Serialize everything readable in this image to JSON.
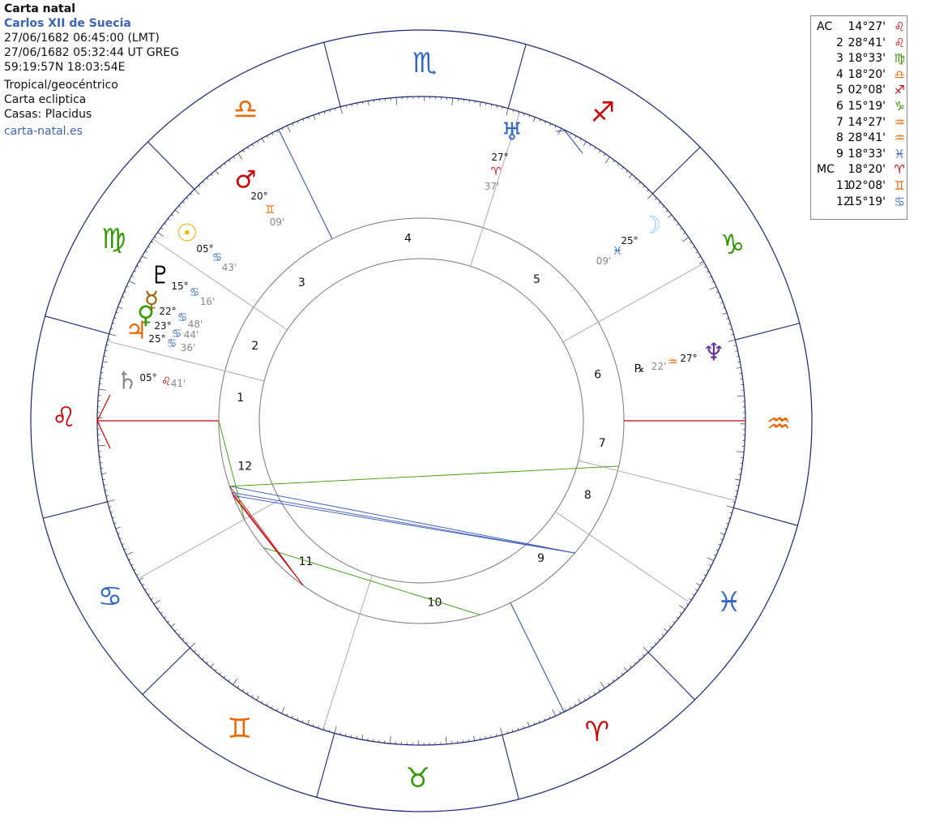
{
  "chart_info": {
    "title": "Carta natal",
    "name": "Carlos XII de Suecia",
    "local_time": "27/06/1682 06:45:00 (LMT)",
    "ut_time": "27/06/1682 05:32:44 UT GREG",
    "coords": "59:19:57N 18:03:54E",
    "system": "Tropical/geocéntrico",
    "chart_type": "Carta ecliptica",
    "houses": "Casas: Placidus",
    "site": "carta-natal.es"
  },
  "house_cusps": [
    {
      "label": "AC",
      "value": "14°27'",
      "sign": "♌",
      "color": "#cc0000"
    },
    {
      "label": "2",
      "value": "28°41'",
      "sign": "♌",
      "color": "#cc0000"
    },
    {
      "label": "3",
      "value": "18°33'",
      "sign": "♍",
      "color": "#339900"
    },
    {
      "label": "4",
      "value": "18°20'",
      "sign": "♎",
      "color": "#ee6600"
    },
    {
      "label": "5",
      "value": "02°08'",
      "sign": "♐",
      "color": "#cc0000"
    },
    {
      "label": "6",
      "value": "15°19'",
      "sign": "♑",
      "color": "#339900"
    },
    {
      "label": "7",
      "value": "14°27'",
      "sign": "♒",
      "color": "#ee6600"
    },
    {
      "label": "8",
      "value": "28°41'",
      "sign": "♒",
      "color": "#ee6600"
    },
    {
      "label": "9",
      "value": "18°33'",
      "sign": "♓",
      "color": "#3366cc"
    },
    {
      "label": "MC",
      "value": "18°20'",
      "sign": "♈",
      "color": "#cc0000"
    },
    {
      "label": "11",
      "value": "02°08'",
      "sign": "♊",
      "color": "#ee6600"
    },
    {
      "label": "12",
      "value": "15°19'",
      "sign": "♋",
      "color": "#3366cc"
    }
  ],
  "zodiac_signs": [
    {
      "name": "aries-icon",
      "glyph": "♈",
      "color": "#cc0000"
    },
    {
      "name": "taurus-icon",
      "glyph": "♉",
      "color": "#339900"
    },
    {
      "name": "gemini-icon",
      "glyph": "♊",
      "color": "#ee6600"
    },
    {
      "name": "cancer-icon",
      "glyph": "♋",
      "color": "#3366cc"
    },
    {
      "name": "leo-icon",
      "glyph": "♌",
      "color": "#cc0000"
    },
    {
      "name": "virgo-icon",
      "glyph": "♍",
      "color": "#339900"
    },
    {
      "name": "libra-icon",
      "glyph": "♎",
      "color": "#ee6600"
    },
    {
      "name": "scorpio-icon",
      "glyph": "♏",
      "color": "#3366cc"
    },
    {
      "name": "sagittarius-icon",
      "glyph": "♐",
      "color": "#cc0000"
    },
    {
      "name": "capricorn-icon",
      "glyph": "♑",
      "color": "#339900"
    },
    {
      "name": "aquarius-icon",
      "glyph": "♒",
      "color": "#ee6600"
    },
    {
      "name": "pisces-icon",
      "glyph": "♓",
      "color": "#3366cc"
    }
  ],
  "planets": [
    {
      "name": "uranus-icon",
      "glyph": "♅",
      "color": "#3366cc",
      "deg": "27°",
      "min": "37'",
      "sign": "♈",
      "sign_color": "#cc0000"
    },
    {
      "name": "mars-icon",
      "glyph": "♂",
      "color": "#cc0000",
      "deg": "20°",
      "min": "09'",
      "sign": "♊",
      "sign_color": "#ee6600"
    },
    {
      "name": "sun-icon",
      "glyph": "☉",
      "color": "#e6b800",
      "deg": "05°",
      "min": "43'",
      "sign": "♋",
      "sign_color": "#3366cc"
    },
    {
      "name": "pluto-icon",
      "glyph": "♇",
      "color": "#000000",
      "deg": "15°",
      "min": "16'",
      "sign": "♋",
      "sign_color": "#3366cc"
    },
    {
      "name": "mercury-icon",
      "glyph": "☿",
      "color": "#996600",
      "deg": "22°",
      "min": "48'",
      "sign": "♋",
      "sign_color": "#3366cc"
    },
    {
      "name": "venus-icon",
      "glyph": "♀",
      "color": "#339900",
      "deg": "23°",
      "min": "44'",
      "sign": "♋",
      "sign_color": "#3366cc"
    },
    {
      "name": "jupiter-icon",
      "glyph": "♃",
      "color": "#ee6600",
      "deg": "25°",
      "min": "36'",
      "sign": "♋",
      "sign_color": "#3366cc"
    },
    {
      "name": "saturn-icon",
      "glyph": "♄",
      "color": "#888888",
      "deg": "05°",
      "min": "41'",
      "sign": "♌",
      "sign_color": "#cc0000"
    },
    {
      "name": "moon-icon",
      "glyph": "☽",
      "color": "#99ccff",
      "deg": "25°",
      "min": "09'",
      "sign": "♓",
      "sign_color": "#3366cc"
    },
    {
      "name": "neptune-icon",
      "glyph": "♆",
      "color": "#663399",
      "deg": "27°",
      "min": "22'",
      "sign": "♒",
      "sign_color": "#ee6600",
      "retro": "℞"
    }
  ],
  "house_numbers": [
    "1",
    "2",
    "3",
    "4",
    "5",
    "6",
    "7",
    "8",
    "9",
    "10",
    "11",
    "12"
  ]
}
